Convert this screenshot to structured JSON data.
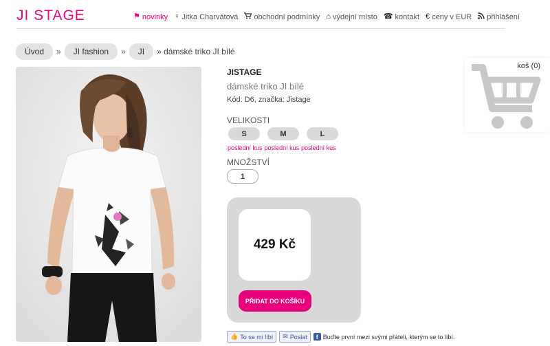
{
  "logo": {
    "text": "JI STAGE"
  },
  "nav": {
    "items": [
      {
        "label": "novinky",
        "icon": "flag-icon",
        "glyph": "⚑",
        "active": true
      },
      {
        "label": "Jitka Charvátová",
        "icon": "woman-icon",
        "glyph": "♀",
        "active": false
      },
      {
        "label": "obchodní podmínky",
        "icon": "cart-icon",
        "glyph": "🛒",
        "active": false
      },
      {
        "label": "výdejní místo",
        "icon": "home-icon",
        "glyph": "⌂",
        "active": false
      },
      {
        "label": "kontakt",
        "icon": "phone-icon",
        "glyph": "☎",
        "active": false
      },
      {
        "label": "ceny v EUR",
        "icon": "euro-icon",
        "glyph": "€",
        "active": false
      },
      {
        "label": "přihlášení",
        "icon": "rss-icon",
        "glyph": "⊚",
        "active": false
      }
    ]
  },
  "breadcrumb": {
    "items": [
      "Úvod",
      "JI fashion",
      "JI"
    ],
    "separator": "»",
    "current": "» dámské triko JI bílé"
  },
  "product": {
    "brand": "JISTAGE",
    "name": "dámské triko JI bílé",
    "code_line": "Kód: D6, značka: Jistage",
    "size_title": "VELIKOSTI",
    "sizes": [
      "S",
      "M",
      "L"
    ],
    "stock_notes": [
      "poslední kus",
      "poslední kus",
      "poslední kus"
    ],
    "qty_title": "MNOŽSTVÍ",
    "qty_value": "1",
    "price": "429 Kč",
    "add_to_cart": "PŘIDAT DO KOŠÍKU"
  },
  "social": {
    "like_label": "To se mi líbí",
    "send_label": "Poslat",
    "fb_text": "Buďte první mezi svými přáteli, kterým se to líbí."
  },
  "cart": {
    "label": "koš (0)"
  },
  "colors": {
    "accent": "#e6007e",
    "panel": "#d8d8d8",
    "crumb": "#e3e3e3"
  }
}
